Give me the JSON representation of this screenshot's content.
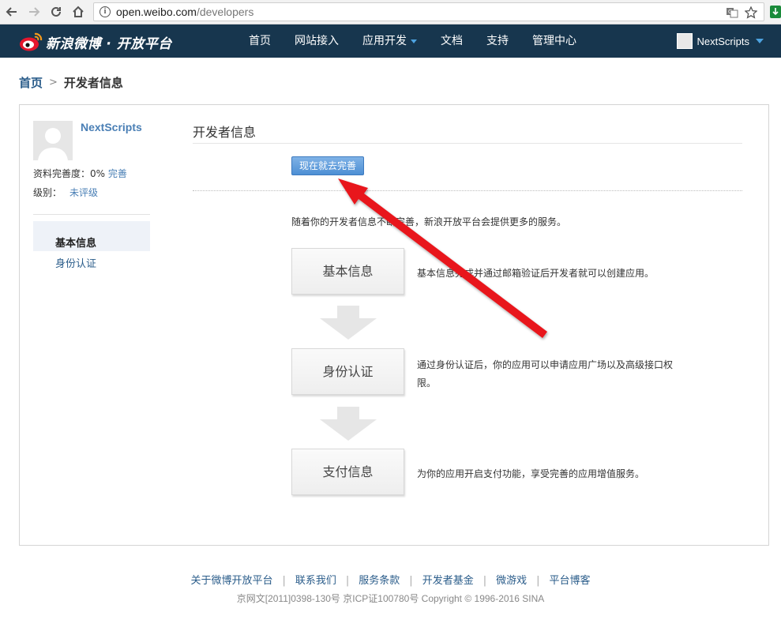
{
  "browser": {
    "url_host": "open.weibo.com",
    "url_path": "/developers"
  },
  "header": {
    "logo_text": "新浪微博 · 开放平台",
    "nav": [
      {
        "label": "首页"
      },
      {
        "label": "网站接入"
      },
      {
        "label": "应用开发"
      },
      {
        "label": "文档"
      },
      {
        "label": "支持"
      },
      {
        "label": "管理中心"
      }
    ],
    "username": "NextScripts"
  },
  "breadcrumb": {
    "home": "首页",
    "separator": ">",
    "current": "开发者信息"
  },
  "sidebar": {
    "username": "NextScripts",
    "profile_completeness_label": "资料完善度：",
    "profile_completeness_value": "0%",
    "complete_link": "完善",
    "level_label": "级别：",
    "level_value": "未评级",
    "menu": [
      {
        "label": "基本信息",
        "active": true
      },
      {
        "label": "身份认证",
        "active": false
      }
    ]
  },
  "content": {
    "title": "开发者信息",
    "complete_button": "现在就去完善",
    "intro": "随着你的开发者信息不断完善，新浪开放平台会提供更多的服务。",
    "steps": [
      {
        "label": "基本信息",
        "description": "基本信息完成并通过邮箱验证后开发者就可以创建应用。"
      },
      {
        "label": "身份认证",
        "description": "通过身份认证后，你的应用可以申请应用广场以及高级接口权限。"
      },
      {
        "label": "支付信息",
        "description": "为你的应用开启支付功能，享受完善的应用增值服务。"
      }
    ]
  },
  "footer": {
    "links": [
      {
        "label": "关于微博开放平台"
      },
      {
        "label": "联系我们"
      },
      {
        "label": "服务条款"
      },
      {
        "label": "开发者基金"
      },
      {
        "label": "微游戏"
      },
      {
        "label": "平台博客"
      }
    ],
    "separator": "|",
    "copyright": "京网文[2011]0398-130号 京ICP证100780号 Copyright © 1996-2016 SINA"
  },
  "colors": {
    "header_bg": "#17364e",
    "link": "#2a5c8a",
    "accent_button": "#4d8fd4",
    "annotation_arrow": "#e8141b"
  }
}
